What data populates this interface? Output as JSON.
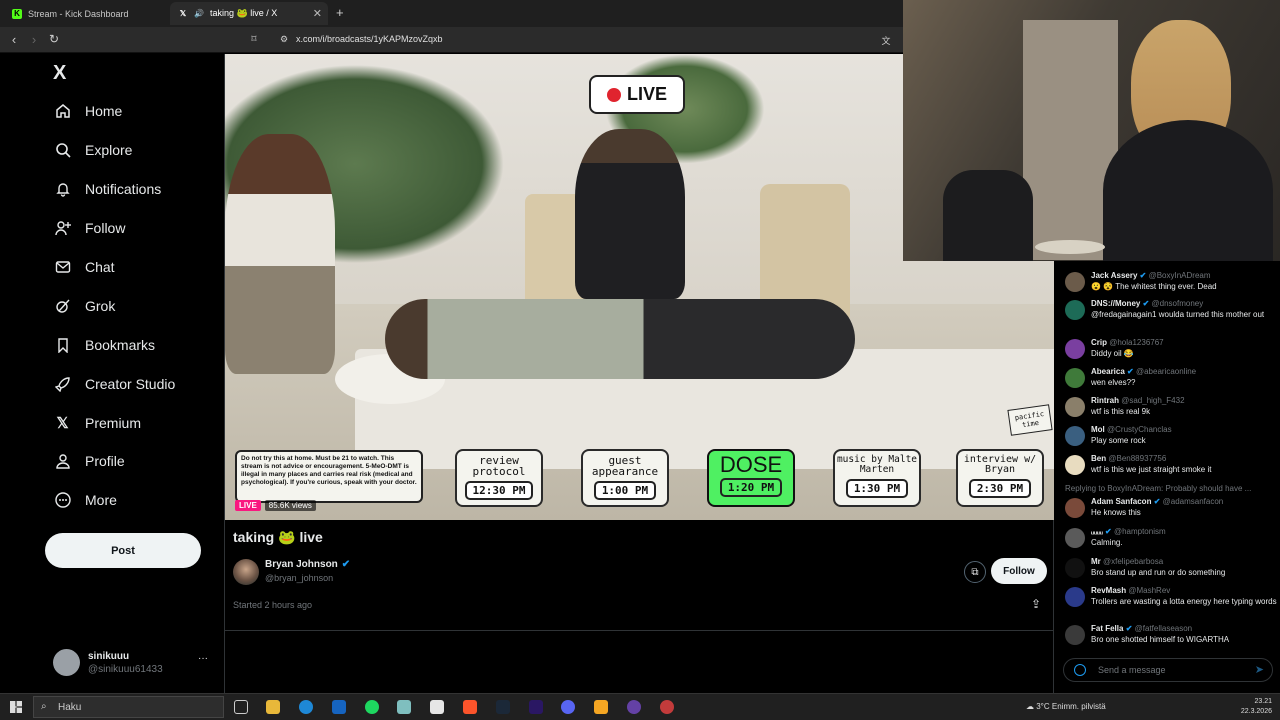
{
  "browser": {
    "tabs": [
      {
        "label": "Stream - Kick Dashboard",
        "active": false
      },
      {
        "label": "taking 🐸 live / X",
        "active": true
      }
    ],
    "new_tab": "+",
    "url": "x.com/i/broadcasts/1yKAPMzovZqxb"
  },
  "sidebar": {
    "logo": "X",
    "items": [
      {
        "label": "Home",
        "icon": "home-icon"
      },
      {
        "label": "Explore",
        "icon": "search-icon"
      },
      {
        "label": "Notifications",
        "icon": "bell-icon"
      },
      {
        "label": "Follow",
        "icon": "person-add-icon"
      },
      {
        "label": "Chat",
        "icon": "mail-icon"
      },
      {
        "label": "Grok",
        "icon": "grok-icon"
      },
      {
        "label": "Bookmarks",
        "icon": "bookmark-icon"
      },
      {
        "label": "Creator Studio",
        "icon": "rocket-icon"
      },
      {
        "label": "Premium",
        "icon": "x-logo-icon"
      },
      {
        "label": "Profile",
        "icon": "person-icon"
      },
      {
        "label": "More",
        "icon": "more-circle-icon"
      }
    ],
    "post_label": "Post",
    "account": {
      "name": "sinikuuu",
      "handle": "@sinikuuu61433",
      "more": "···"
    }
  },
  "video": {
    "live_badge": "LIVE",
    "disclaimer": "Do not try this at home. Must be 21 to watch. This stream is not advice or encouragement. 5-MeO-DMT is illegal in many places and carries real risk (medical and psychological). If you're curious, speak with your doctor.",
    "corner_label": "pacific time",
    "schedule": [
      {
        "title": "review protocol",
        "time": "12:30 PM"
      },
      {
        "title": "guest appearance",
        "time": "1:00 PM"
      },
      {
        "title": "DOSE",
        "time": "1:20 PM"
      },
      {
        "title": "music by Malte Marten",
        "time": "1:30 PM"
      },
      {
        "title": "interview w/ Bryan",
        "time": "2:30 PM"
      }
    ],
    "live_pill": "LIVE",
    "views": "85.6K views"
  },
  "broadcast": {
    "title": "taking 🐸 live",
    "host_name": "Bryan Johnson",
    "host_handle": "@bryan_johnson",
    "follow_label": "Follow",
    "started": "Started 2 hours ago"
  },
  "chat": {
    "messages": [
      {
        "name": "Jack Assery",
        "handle": "@BoxyInADream",
        "text": "😮 😵 The whitest thing ever. Dead",
        "verified": true,
        "color": "#6b5b4a"
      },
      {
        "name": "DNS://Money",
        "handle": "@dnsofmoney",
        "text": "@fredagainagain1 woulda turned this mother out",
        "verified": true,
        "color": "#1d6b57"
      },
      {
        "name": "Crip",
        "handle": "@hola1236767",
        "text": "Diddy oil 😂",
        "verified": false,
        "color": "#7a3fa0"
      },
      {
        "name": "Abearica",
        "handle": "@abearicaonline",
        "text": "wen elves??",
        "verified": true,
        "color": "#3f7a3a"
      },
      {
        "name": "Rintrah",
        "handle": "@sad_high_F432",
        "text": "wtf is this real 9k",
        "verified": false,
        "color": "#8a7f6a"
      },
      {
        "name": "Mol",
        "handle": "@CrustyChanclas",
        "text": "Play some rock",
        "verified": false,
        "color": "#3a5f80"
      },
      {
        "name": "Ben",
        "handle": "@Ben88937756",
        "text": "wtf is this we just straight smoke it",
        "verified": false,
        "color": "#e8dcc0"
      },
      {
        "name": "Adam Sanfacon",
        "handle": "@adamsanfacon",
        "text": "He knows this",
        "verified": true,
        "color": "#7a4a3a"
      },
      {
        "name": "ᵤᵤᵤᵤ",
        "handle": "@hamptonism",
        "text": "Calming.",
        "verified": true,
        "color": "#5a5a5a"
      },
      {
        "name": "Mr",
        "handle": "@xfelipebarbosa",
        "text": "Bro stand up and run or do something",
        "verified": false,
        "color": "#111111"
      },
      {
        "name": "RevMash",
        "handle": "@MashRev",
        "text": "Trollers are wasting a lotta energy here typing words",
        "verified": false,
        "color": "#2a3a8a"
      },
      {
        "name": "Fat Fella",
        "handle": "@fatfellaseason",
        "text": "Bro one shotted himself to WIGARTHA",
        "verified": true,
        "color": "#3a3a3a"
      }
    ],
    "replying": "Replying to BoxyInADream: Probably should have ...",
    "input_placeholder": "Send a message"
  },
  "taskbar": {
    "search_placeholder": "Haku",
    "weather": "3°C  Enimm. pilvistä",
    "time": "23.21",
    "date": "22.3.2026"
  }
}
